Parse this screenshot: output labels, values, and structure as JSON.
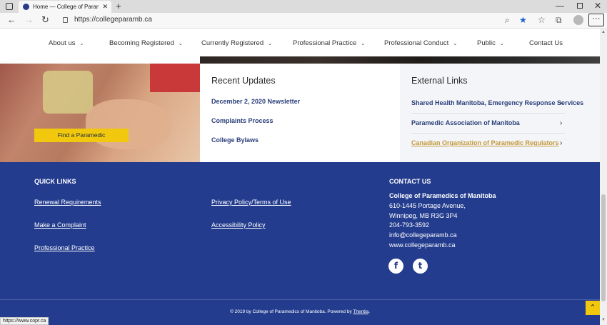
{
  "browser": {
    "tab_title": "Home — College of Paramedics",
    "tab_close": "✕",
    "new_tab": "+",
    "url": "https://collegeparamb.ca",
    "status_url": "https://www.copr.ca"
  },
  "nav": {
    "items": [
      {
        "label": "About us",
        "has_dropdown": true
      },
      {
        "label": "Becoming Registered",
        "has_dropdown": true
      },
      {
        "label": "Currently Registered",
        "has_dropdown": true
      },
      {
        "label": "Professional Practice",
        "has_dropdown": true
      },
      {
        "label": "Professional Conduct",
        "has_dropdown": true
      },
      {
        "label": "Public",
        "has_dropdown": true
      },
      {
        "label": "Contact Us",
        "has_dropdown": false
      }
    ]
  },
  "hero": {
    "find_button": "Find a Paramedic"
  },
  "recent_updates": {
    "title": "Recent Updates",
    "links": [
      "December 2, 2020 Newsletter",
      "Complaints Process",
      "College Bylaws"
    ]
  },
  "external_links": {
    "title": "External Links",
    "links": [
      "Shared Health Manitoba, Emergency Response Services",
      "Paramedic Association of Manitoba",
      "Canadian Organization of Paramedic Regulators"
    ]
  },
  "footer": {
    "quick_links_title": "QUICK LINKS",
    "quick_links_col1": [
      "Renewal Requirements",
      "Make a Complaint",
      "Professional Practice"
    ],
    "quick_links_col2": [
      "Privacy Policy/Terms of Use",
      "Accessibility Policy"
    ],
    "contact_title": "CONTACT US",
    "contact_org": "College of Paramedics of Manitoba",
    "contact_address1": "610-1445 Portage Avenue,",
    "contact_address2": "Winnipeg, MB R3G 3P4",
    "contact_phone": "204-793-3592",
    "contact_email": "info@collegeparamb.ca",
    "contact_web": "www.collegeparamb.ca",
    "social_facebook": "f",
    "social_twitter": "t",
    "copyright_prefix": "© 2019 by College of Paramedics of Manitoba. Powered by ",
    "copyright_link": "Thentia",
    "copyright_suffix": "."
  },
  "colors": {
    "footer_bg": "#233c8e",
    "accent_yellow": "#f1c80d",
    "link_blue": "#2a3f7a",
    "visited_gold": "#c2993a"
  }
}
